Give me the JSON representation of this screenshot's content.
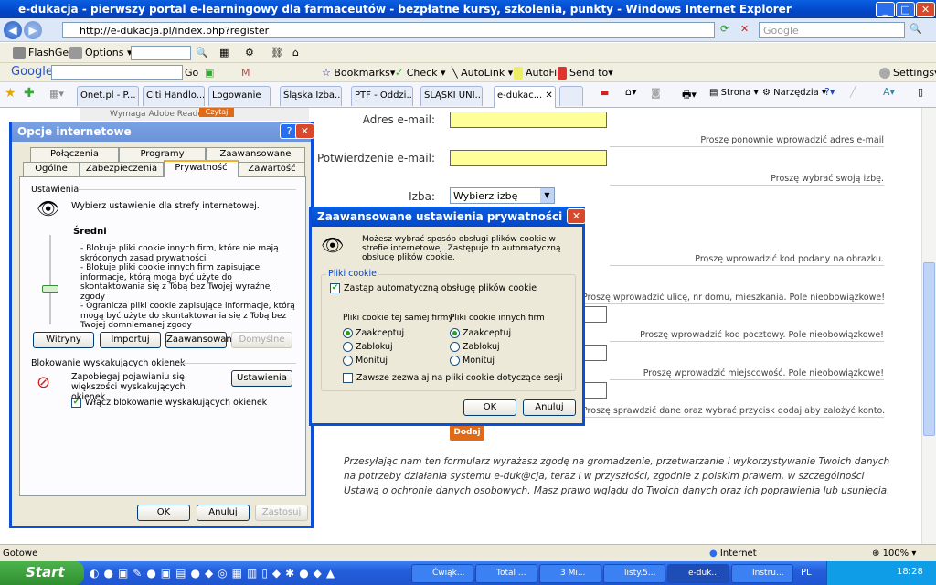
{
  "window": {
    "title": "e-dukacja - pierwszy portal e-learningowy dla farmaceutów - bezpłatne kursy, szkolenia, punkty - Windows Internet Explorer"
  },
  "address": {
    "url": "http://e-dukacja.pl/index.php?register",
    "search_placeholder": "Google"
  },
  "toolbar1": {
    "flashget": "FlashGet",
    "options": "Options"
  },
  "toolbar2": {
    "google": "Google",
    "go": "Go",
    "bookmarks": "Bookmarks▾",
    "check": "Check ▾",
    "autolink": "AutoLink ▾",
    "autofill": "AutoFill",
    "sendto": "Send to▾",
    "settings": "Settings▾"
  },
  "tabs": [
    {
      "label": "Onet.pl - P..."
    },
    {
      "label": "Citi Handlo..."
    },
    {
      "label": "Logowanie"
    },
    {
      "label": "Śląska Izba..."
    },
    {
      "label": "PTF - Oddzi..."
    },
    {
      "label": "ŚLĄSKI UNI..."
    },
    {
      "label": "e-dukac..."
    }
  ],
  "commandbar": {
    "page": "Strona ▾",
    "tools": "Narzędzia ▾"
  },
  "page": {
    "adobe_note": "Wymaga Adobe Reader",
    "read_button": "Czytaj",
    "email_label": "Adres e-mail:",
    "email_confirm_label": "Potwierdzenie e-mail:",
    "izba_label": "Izba:",
    "izba_value": "Wybierz izbę",
    "hints": [
      "Proszę ponownie wprowadzić adres e-mail",
      "Proszę wybrać swoją izbę.",
      "Proszę wprowadzić kod podany na obrazku.",
      "Proszę wprowadzić ulicę, nr domu, mieszkania. Pole nieobowiązkowe!",
      "Proszę wprowadzić kod pocztowy. Pole nieobowiązkowe!",
      "Proszę wprowadzić miejscowość. Pole nieobowiązkowe!",
      "Proszę sprawdzić dane oraz wybrać przycisk dodaj aby założyć konto."
    ],
    "add_button": "Dodaj",
    "consent": "Przesyłając nam ten formularz wyrażasz zgodę na gromadzenie, przetwarzanie i wykorzystywanie Twoich danych na potrzeby działania systemu e-duk@cja, teraz i w przyszłości, zgodnie z polskim prawem, w szczególności Ustawą o ochronie danych osobowych. Masz prawo wglądu do Twoich danych oraz ich poprawienia lub usunięcia."
  },
  "options_dialog": {
    "title": "Opcje internetowe",
    "tabs_row1": [
      "Połączenia",
      "Programy",
      "Zaawansowane"
    ],
    "tabs_row2": [
      "Ogólne",
      "Zabezpieczenia",
      "Prywatność",
      "Zawartość"
    ],
    "settings_group": "Ustawienia",
    "zone_text": "Wybierz ustawienie dla strefy internetowej.",
    "level": "Średni",
    "privacy_level_step": 3,
    "privacy_level_steps": 6,
    "level_desc": "- Blokuje pliki cookie innych firm, które nie mają skróconych zasad prywatności\n- Blokuje pliki cookie innych firm zapisujące informacje, którą mogą być użyte do skontaktowania się z Tobą bez Twojej wyraźnej zgody\n- Ogranicza pliki cookie zapisujące informacje, którą mogą być użyte do skontaktowania się z Tobą bez Twojej domniemanej zgody",
    "buttons": {
      "sites": "Witryny",
      "import": "Importuj",
      "advanced": "Zaawansowane",
      "default": "Domyślne"
    },
    "popup_group": "Blokowanie wyskakujących okienek",
    "popup_text": "Zapobiegaj pojawianiu się większości wyskakujących okienek.",
    "popup_settings": "Ustawienia",
    "popup_checkbox": "Włącz blokowanie wyskakujących okienek",
    "popup_checked": true,
    "ok": "OK",
    "cancel": "Anuluj",
    "apply": "Zastosuj"
  },
  "adv_dialog": {
    "title": "Zaawansowane ustawienia prywatności",
    "intro": "Możesz wybrać sposób obsługi plików cookie w strefie internetowej. Zastępuje to automatyczną obsługę plików cookie.",
    "group": "Pliki cookie",
    "override": "Zastąp automatyczną obsługę plików cookie",
    "override_checked": true,
    "first_party": {
      "label": "Pliki cookie tej samej firmy",
      "options": [
        "Zaakceptuj",
        "Zablokuj",
        "Monituj"
      ],
      "selected": "Zaakceptuj"
    },
    "third_party": {
      "label": "Pliki cookie innych firm",
      "options": [
        "Zaakceptuj",
        "Zablokuj",
        "Monituj"
      ],
      "selected": "Zaakceptuj"
    },
    "session": "Zawsze zezwalaj na pliki cookie dotyczące sesji",
    "session_checked": false,
    "ok": "OK",
    "cancel": "Anuluj"
  },
  "status": {
    "text": "Gotowe",
    "zone": "Internet",
    "zoom": "100%"
  },
  "taskbar": {
    "start": "Start",
    "tasks": [
      "Ćwiąk...",
      "Total ...",
      "3 Mi...",
      "listy.5...",
      "e-duk...",
      "Instru..."
    ],
    "lang": "PL",
    "clock": "18:28"
  }
}
